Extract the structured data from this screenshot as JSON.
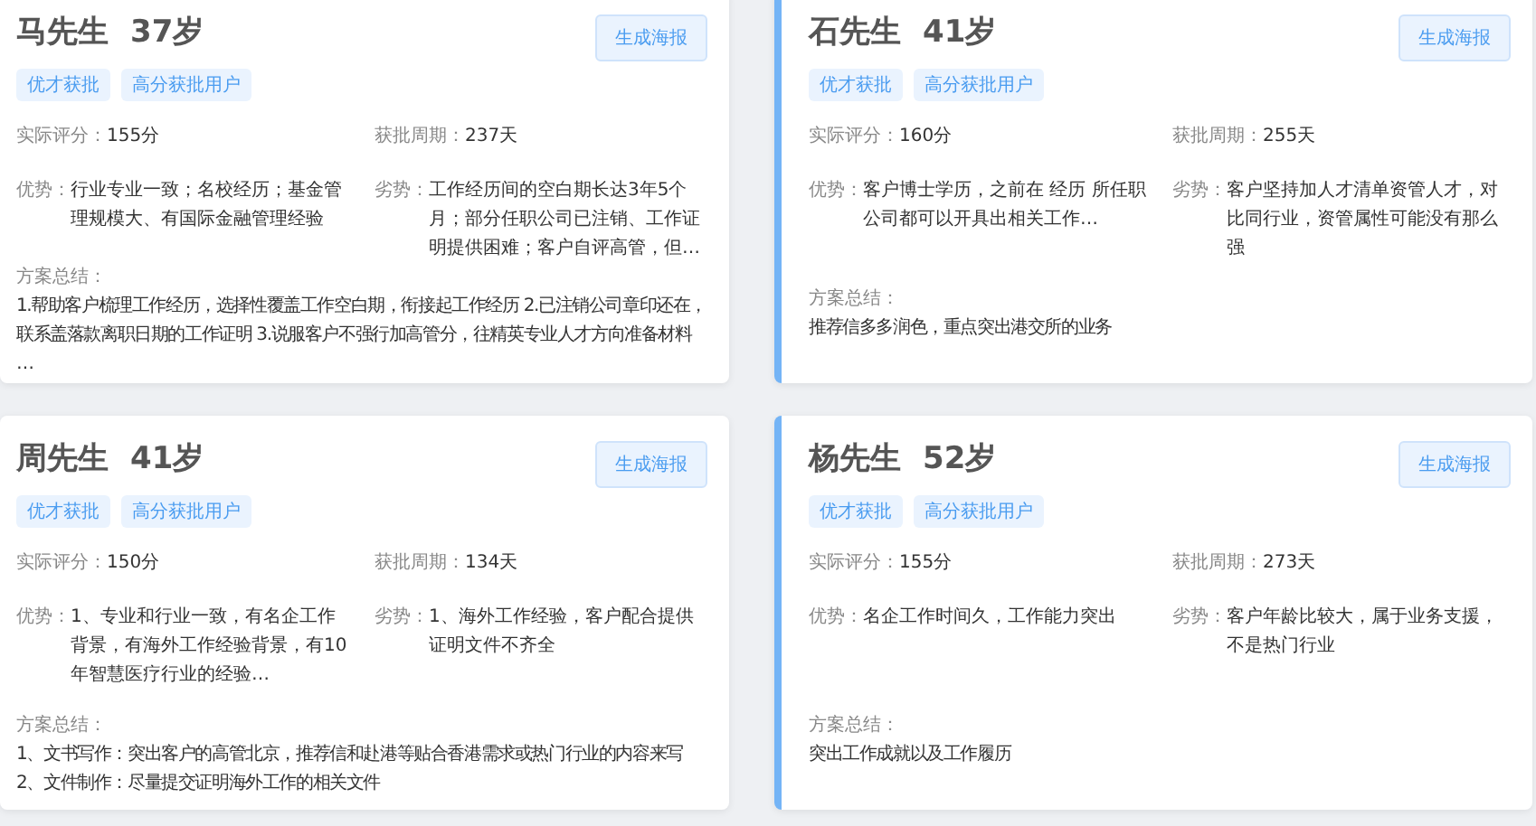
{
  "cards": [
    {
      "name": "马先生",
      "age": "37岁",
      "highlighted": false,
      "button": "生成海报",
      "tags": [
        "优才获批",
        "高分获批用户"
      ],
      "score_label": "实际评分：",
      "score": "155分",
      "period_label": "获批周期：",
      "period": "237天",
      "pros_label": "优势：",
      "pros": "行业专业一致；名校经历；基金管理规模大、有国际金融管理经验",
      "cons_label": "劣势：",
      "cons": "工作经历间的空白期长达3年5个月；部分任职公司已注销、工作证明提供困难；客户自评高管，但…",
      "summary_label": "方案总结：",
      "summary": "1.帮助客户梳理工作经历，选择性覆盖工作空白期，衔接起工作经历 2.已注销公司章印还在，联系盖落款离职日期的工作证明 3.说服客户不强行加高管分，往精英专业人才方向准备材料 …"
    },
    {
      "name": "石先生",
      "age": "41岁",
      "highlighted": true,
      "button": "生成海报",
      "tags": [
        "优才获批",
        "高分获批用户"
      ],
      "score_label": "实际评分：",
      "score": "160分",
      "period_label": "获批周期：",
      "period": "255天",
      "pros_label": "优势：",
      "pros": "客户博士学历，之前在 经历 所任职公司都可以开具出相关工作…",
      "cons_label": "劣势：",
      "cons": "客户坚持加人才清单资管人才，对比同行业，资管属性可能没有那么强",
      "summary_label": "方案总结：",
      "summary": "推荐信多多润色，重点突出港交所的业务"
    },
    {
      "name": "周先生",
      "age": "41岁",
      "highlighted": false,
      "button": "生成海报",
      "tags": [
        "优才获批",
        "高分获批用户"
      ],
      "score_label": "实际评分：",
      "score": "150分",
      "period_label": "获批周期：",
      "period": "134天",
      "pros_label": "优势：",
      "pros": "1、专业和行业一致，有名企工作背景，有海外工作经验背景，有10年智慧医疗行业的经验…",
      "cons_label": "劣势：",
      "cons": "1、海外工作经验，客户配合提供证明文件不齐全",
      "summary_label": "方案总结：",
      "summary": "1、文书写作：突出客户的高管北京，推荐信和赴港等贴合香港需求或热门行业的内容来写 2、文件制作：尽量提交证明海外工作的相关文件"
    },
    {
      "name": "杨先生",
      "age": "52岁",
      "highlighted": true,
      "button": "生成海报",
      "tags": [
        "优才获批",
        "高分获批用户"
      ],
      "score_label": "实际评分：",
      "score": "155分",
      "period_label": "获批周期：",
      "period": "273天",
      "pros_label": "优势：",
      "pros": "名企工作时间久，工作能力突出",
      "cons_label": "劣势：",
      "cons": "客户年龄比较大，属于业务支援，不是热门行业",
      "summary_label": "方案总结：",
      "summary": "突出工作成就以及工作履历"
    }
  ]
}
